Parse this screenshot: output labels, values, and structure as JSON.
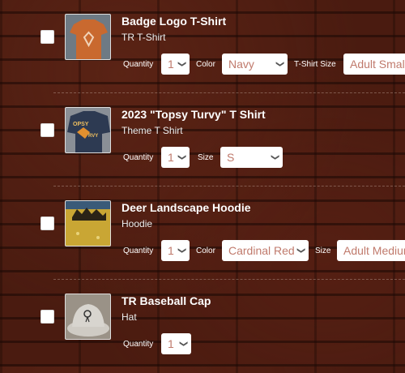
{
  "items": [
    {
      "title": "Badge Logo T-Shirt",
      "subtitle": "TR T-Shirt",
      "thumb_icon": "orange-tshirt-image",
      "quantity_label": "Quantity",
      "quantity": "1",
      "color_label": "Color",
      "color": "Navy",
      "size_label": "T-Shirt Size",
      "size": "Adult Small"
    },
    {
      "title": "2023 \"Topsy Turvy\" T Shirt",
      "subtitle": "Theme T Shirt",
      "thumb_icon": "navy-tshirt-image",
      "quantity_label": "Quantity",
      "quantity": "1",
      "size_label": "Size",
      "size": "S"
    },
    {
      "title": "Deer Landscape Hoodie",
      "subtitle": "Hoodie",
      "thumb_icon": "yellow-hoodie-image",
      "quantity_label": "Quantity",
      "quantity": "1",
      "color_label": "Color",
      "color": "Cardinal Red",
      "size_label": "Size",
      "size": "Adult Medium"
    },
    {
      "title": "TR Baseball Cap",
      "subtitle": "Hat",
      "thumb_icon": "gray-cap-image",
      "quantity_label": "Quantity",
      "quantity": "1"
    }
  ],
  "chevron_icon": "chevron-down-icon",
  "colors": {
    "background": "#4a1b10",
    "select_text": "#c07a6c"
  }
}
